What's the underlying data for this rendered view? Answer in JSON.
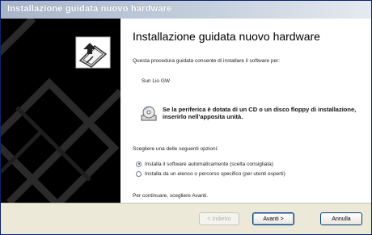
{
  "window": {
    "title": "Installazione guidata nuovo hardware"
  },
  "wizard": {
    "heading": "Installazione guidata nuovo hardware",
    "intro": "Questa procedura guidata consente di installare il software per:",
    "device_name": "Sun Lio GW",
    "cd_note": "Se la periferica è dotata di un CD o un disco floppy di installazione, inserirlo nell'apposita unità.",
    "choose_prompt": "Scegliere una delle seguenti opzioni:",
    "options": [
      {
        "label": "Installa il software automaticamente (scelta consigliata)",
        "selected": true
      },
      {
        "label": "Installa da un elenco o percorso specifico (per utenti esperti)",
        "selected": false
      }
    ],
    "continue_prompt": "Per continuare, scegliere Avanti."
  },
  "buttons": {
    "back_label": "< Indietro",
    "next_label": "Avanti >",
    "cancel_label": "Annulla"
  },
  "icons": {
    "wizard_graphic": "hardware-wizard-icon",
    "cd": "cd-icon"
  }
}
